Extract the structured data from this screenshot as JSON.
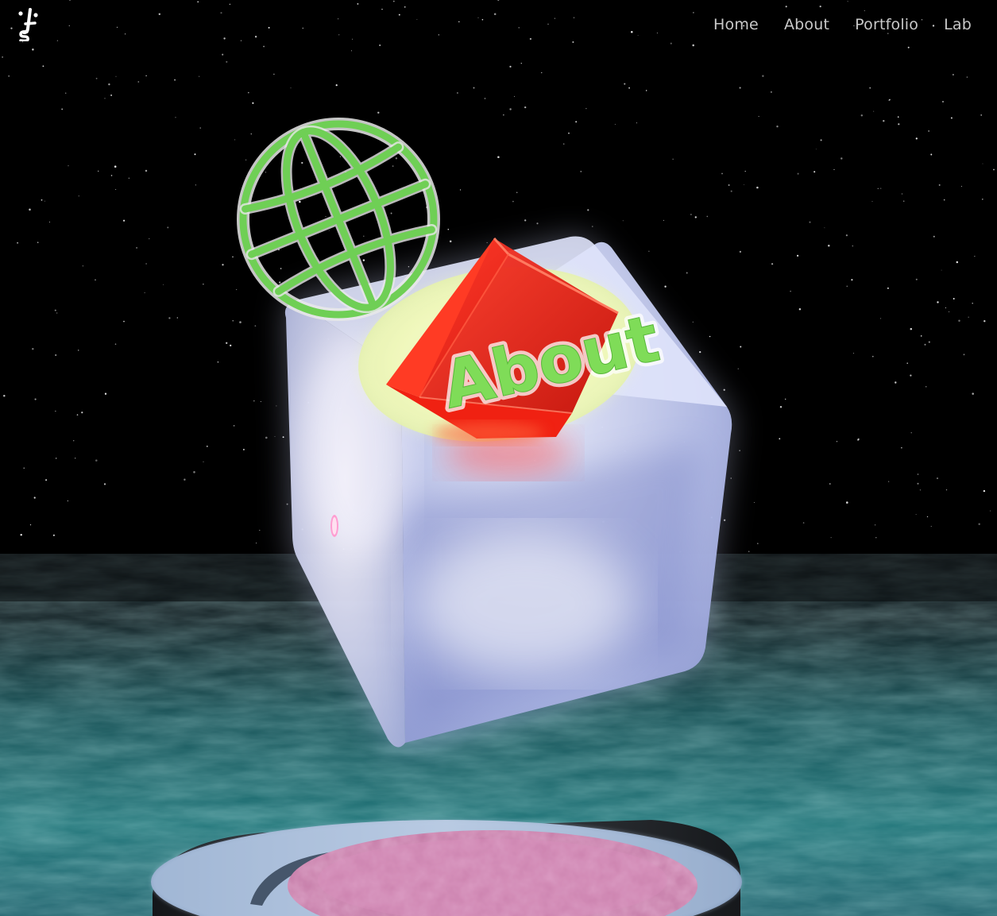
{
  "brand": {
    "logo_icon": "js-monogram-logo-icon",
    "logo_text": "JS"
  },
  "nav": {
    "items": [
      {
        "label": "Home"
      },
      {
        "label": "About"
      },
      {
        "label": "Portfolio"
      },
      {
        "label": "Lab"
      }
    ]
  },
  "scene": {
    "cube_label": "About",
    "globe_icon": "globe-icon",
    "colors": {
      "sky": "#000000",
      "sea": "#1f6e70",
      "glass_cube": "#cfd6f2",
      "red_cube": "#e01a12",
      "label_green": "#7fdc58",
      "globe_green": "#6fcf55",
      "glow_yellow": "#f2f9c2",
      "pedestal_pink": "#cf7fb0",
      "pedestal_rim": "#8ea7c9"
    }
  }
}
